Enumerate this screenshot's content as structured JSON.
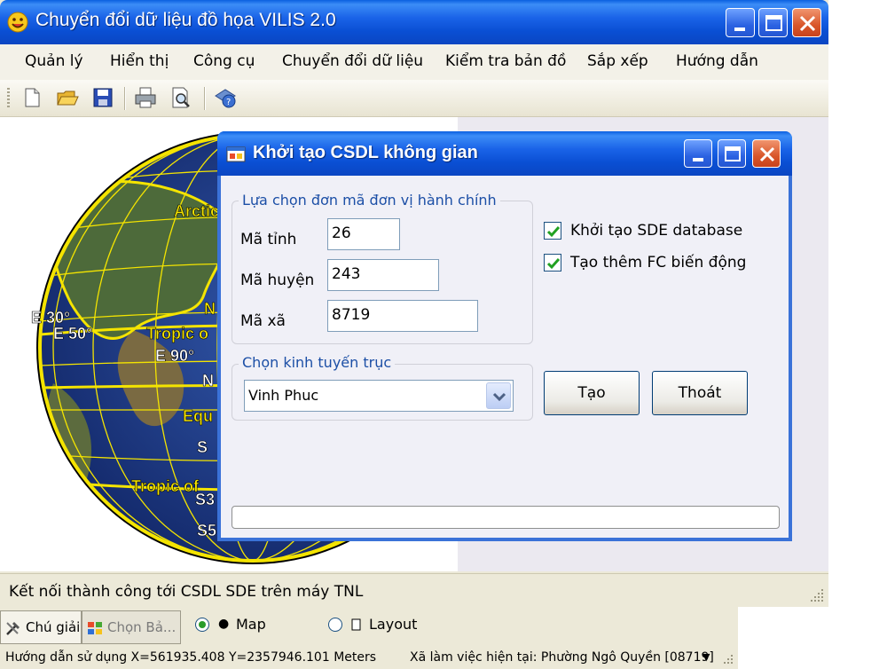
{
  "app": {
    "title": "Chuyển đổi dữ liệu đồ họa VILIS 2.0"
  },
  "menu": {
    "items": [
      "Quản lý",
      "Hiển thị",
      "Công cụ",
      "Chuyển đổi dữ liệu",
      "Kiểm tra bản đồ",
      "Sắp xếp",
      "Hướng dẫn"
    ]
  },
  "toolbar": {
    "icons": [
      "new-file-icon",
      "open-folder-icon",
      "save-icon",
      "print-icon",
      "print-preview-icon",
      "help-globe-icon"
    ]
  },
  "map": {
    "labels": [
      "Arctic",
      "N",
      "E 30°",
      "E 50°",
      "Tropic o",
      "E 90°",
      "N",
      "Equ",
      "S",
      "Tropic of",
      "S3",
      "S5"
    ]
  },
  "dialog": {
    "title": "Khởi tạo CSDL không gian",
    "group_admin": {
      "legend": "Lựa chọn đơn mã đơn vị hành chính",
      "province_label": "Mã tỉnh",
      "province_value": "26",
      "district_label": "Mã huyện",
      "district_value": "243",
      "commune_label": "Mã xã",
      "commune_value": "8719"
    },
    "group_meridian": {
      "legend": "Chọn kinh tuyến trục",
      "selected": "Vinh Phuc"
    },
    "checkboxes": {
      "create_sde_label": "Khởi tạo SDE database",
      "create_sde_checked": true,
      "add_fc_label": "Tạo thêm FC biến động",
      "add_fc_checked": true
    },
    "buttons": {
      "create_label": "Tạo",
      "exit_label": "Thoát"
    },
    "progress": 0
  },
  "status": {
    "message": "Kết nối thành công tới CSDL SDE trên máy TNL"
  },
  "bottom": {
    "tab_legend": "Chú giải",
    "tab_choose": "Chọn Bả...",
    "view_map": "Map",
    "view_layout": "Layout",
    "view_selected": "Map",
    "coords": "Hướng dẫn sử dụng X=561935.408 Y=2357946.101 Meters",
    "workspace": "Xã làm việc hiện tại: Phường Ngô Quyền [08719]"
  },
  "colors": {
    "titlebar": "#0a4fd4",
    "globe_grid": "#f4e400",
    "ocean": "#1f3a8a",
    "legend_text": "#1c4fa6"
  }
}
